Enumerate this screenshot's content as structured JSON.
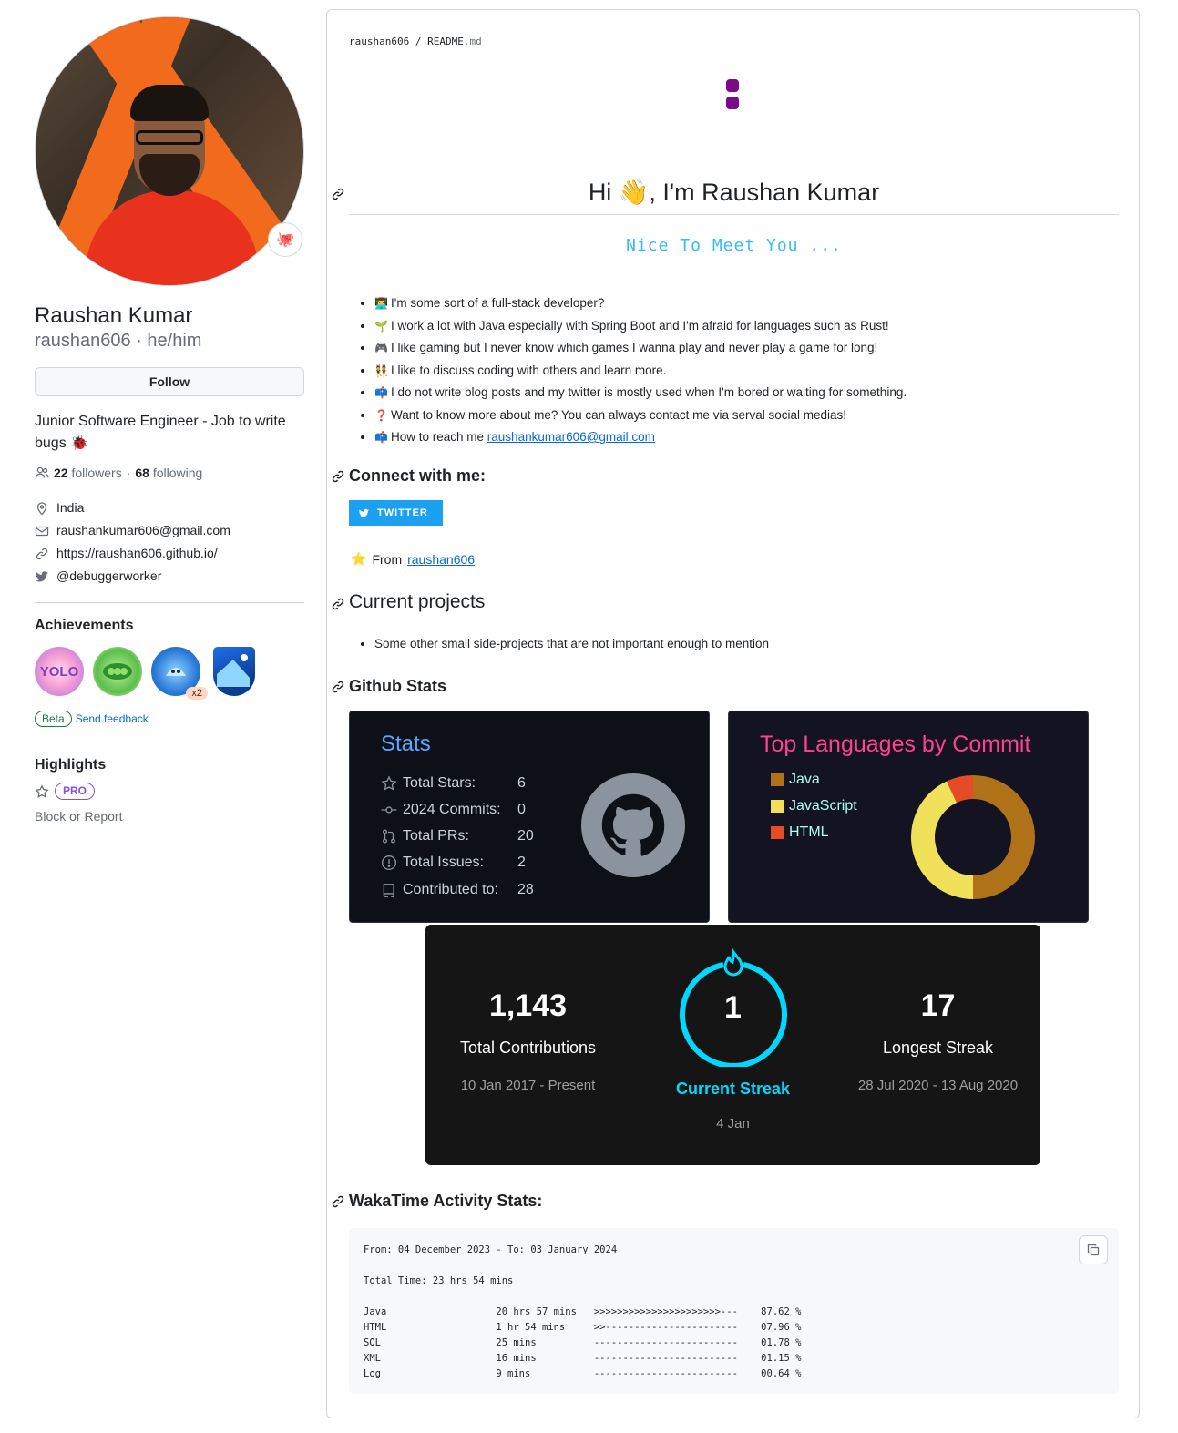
{
  "profile": {
    "name": "Raushan Kumar",
    "login_line": "raushan606 · he/him",
    "follow_label": "Follow",
    "bio": "Junior Software Engineer - Job to write bugs 🐞",
    "followers_count": "22",
    "followers_label": "followers",
    "following_count": "68",
    "following_label": "following",
    "separator": "·",
    "location": "India",
    "email": "raushankumar606@gmail.com",
    "website": "https://raushan606.github.io/",
    "twitter": "@debuggerworker",
    "status_emoji": "🐙"
  },
  "achievements": {
    "title": "Achievements",
    "badges": [
      {
        "name": "yolo",
        "text": "YOLO"
      },
      {
        "name": "pair-extraordinaire",
        "text": ""
      },
      {
        "name": "pull-shark",
        "text": "",
        "count": "x2"
      },
      {
        "name": "arctic-code-vault",
        "text": ""
      }
    ],
    "beta_label": "Beta",
    "feedback_label": "Send feedback"
  },
  "highlights": {
    "title": "Highlights",
    "pro_label": "PRO",
    "block_label": "Block or Report"
  },
  "readme": {
    "breadcrumb_user": "raushan606",
    "breadcrumb_sep": "/",
    "breadcrumb_file": "README",
    "breadcrumb_ext": ".md",
    "greeting": "Hi 👋, I'm Raushan Kumar",
    "typing_text": "Nice To Meet You ...",
    "bullets": [
      {
        "emoji": "👨‍💻",
        "text": "I'm some sort of a full-stack developer?"
      },
      {
        "emoji": "🌱",
        "text": "I work a lot with Java especially with Spring Boot and I'm afraid for languages such as Rust!"
      },
      {
        "emoji": "🎮",
        "text": "I like gaming but I never know which games I wanna play and never play a game for long!"
      },
      {
        "emoji": "👯",
        "text": "I like to discuss coding with others and learn more."
      },
      {
        "emoji": "📫",
        "text": "I do not write blog posts and my twitter is mostly used when I'm bored or waiting for something."
      },
      {
        "emoji": "❓",
        "text": "Want to know more about me? You can always contact me via serval social medias!"
      },
      {
        "emoji": "📫",
        "text": "How to reach me ",
        "link": "raushankumar606@gmail.com"
      }
    ],
    "connect_title": "Connect with me:",
    "twitter_button": "TWITTER",
    "from_label": "From",
    "from_link": "raushan606",
    "projects_title": "Current projects",
    "projects": [
      "Some other small side-projects that are not important enough to mention"
    ],
    "github_stats_title": "Github Stats",
    "wakatime_title": "WakaTime Activity Stats:"
  },
  "stats_card": {
    "title": "Stats",
    "rows": [
      {
        "label": "Total Stars:",
        "value": "6",
        "icon": "star-icon"
      },
      {
        "label": "2024 Commits:",
        "value": "0",
        "icon": "commit-icon"
      },
      {
        "label": "Total PRs:",
        "value": "20",
        "icon": "pull-request-icon"
      },
      {
        "label": "Total Issues:",
        "value": "2",
        "icon": "issue-icon"
      },
      {
        "label": "Contributed to:",
        "value": "28",
        "icon": "repo-icon"
      }
    ]
  },
  "languages_card": {
    "title": "Top Languages by Commit",
    "items": [
      {
        "name": "Java",
        "color": "#b07219"
      },
      {
        "name": "JavaScript",
        "color": "#f1e05a"
      },
      {
        "name": "HTML",
        "color": "#e34c26"
      }
    ],
    "shares": [
      0.5,
      0.43,
      0.07
    ]
  },
  "streak_card": {
    "total": "1,143",
    "total_label": "Total Contributions",
    "total_range": "10 Jan 2017 - Present",
    "current": "1",
    "current_label": "Current Streak",
    "current_range": "4 Jan",
    "longest": "17",
    "longest_label": "Longest Streak",
    "longest_range": "28 Jul 2020 - 13 Aug 2020"
  },
  "wakatime": {
    "lines": [
      "From: 04 December 2023 - To: 03 January 2024",
      "",
      "Total Time: 23 hrs 54 mins",
      "",
      "Java                   20 hrs 57 mins   >>>>>>>>>>>>>>>>>>>>>>---    87.62 %",
      "HTML                   1 hr 54 mins     >>-----------------------    07.96 %",
      "SQL                    25 mins          -------------------------    01.78 %",
      "XML                    16 mins          -------------------------    01.15 %",
      "Log                    9 mins           -------------------------    00.64 %"
    ]
  },
  "colors": {
    "accent": "#0969da",
    "twitter": "#1ca0f2",
    "typing": "#36bcf7",
    "streak_ring": "#00d8ff"
  }
}
